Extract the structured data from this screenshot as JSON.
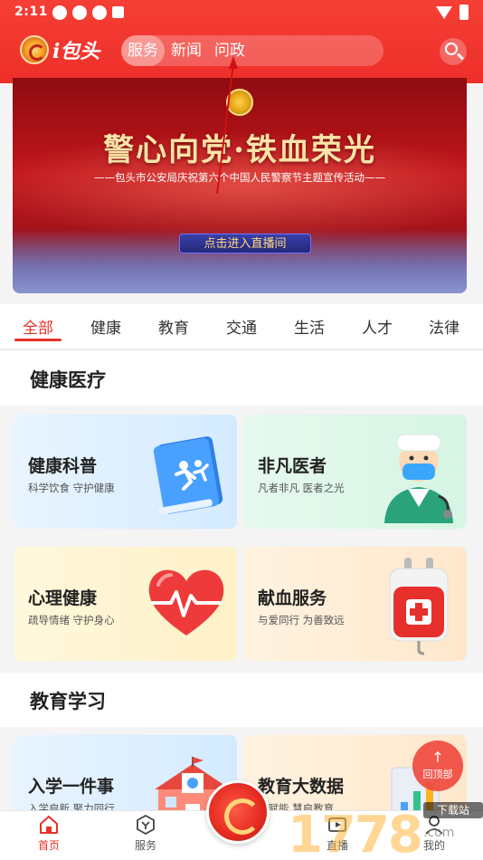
{
  "status_bar": {
    "time": "2:11",
    "left_icons": [
      "notification-icon",
      "notification-icon",
      "notification-icon",
      "app-icon"
    ],
    "right_icons": [
      "wifi-icon",
      "battery-icon"
    ]
  },
  "header": {
    "logo_text": "i包头",
    "nav": [
      {
        "label": "服务",
        "active": true
      },
      {
        "label": "新闻",
        "active": false
      },
      {
        "label": "问政",
        "active": false
      }
    ],
    "search_icon": "search-icon",
    "accent_color": "#ee2f2a"
  },
  "banner": {
    "title": "警心向党·铁血荣光",
    "subtitle": "——包头市公安局庆祝第六个中国人民警察节主题宣传活动——",
    "cta": "点击进入直播间"
  },
  "tabs": [
    {
      "label": "全部",
      "active": true
    },
    {
      "label": "健康",
      "active": false
    },
    {
      "label": "教育",
      "active": false
    },
    {
      "label": "交通",
      "active": false
    },
    {
      "label": "生活",
      "active": false
    },
    {
      "label": "人才",
      "active": false
    },
    {
      "label": "法律",
      "active": false
    }
  ],
  "sections": [
    {
      "title": "健康医疗",
      "cards": [
        {
          "title": "健康科普",
          "subtitle": "科学饮食  守护健康",
          "icon": "book-icon"
        },
        {
          "title": "非凡医者",
          "subtitle": "凡者非凡  医者之光",
          "icon": "doctor-icon"
        },
        {
          "title": "心理健康",
          "subtitle": "疏导情绪  守护身心",
          "icon": "heart-icon"
        },
        {
          "title": "献血服务",
          "subtitle": "与爱同行  为善致远",
          "icon": "blood-bag-icon"
        }
      ]
    },
    {
      "title": "教育学习",
      "cards": [
        {
          "title": "入学一件事",
          "subtitle": "入学启新  聚力同行",
          "icon": "school-icon"
        },
        {
          "title": "教育大数据",
          "subtitle": "智赋能  慧启教育",
          "icon": "data-chart-icon"
        }
      ]
    }
  ],
  "back_to_top": {
    "label": "回顶部",
    "arrow": "↑"
  },
  "bottom_nav": [
    {
      "label": "首页",
      "icon": "home-icon",
      "active": true
    },
    {
      "label": "服务",
      "icon": "service-icon",
      "active": false
    },
    {
      "label": "直播",
      "icon": "live-icon",
      "active": false
    },
    {
      "label": "我的",
      "icon": "user-icon",
      "active": false
    }
  ],
  "watermark": {
    "number": "1778",
    "tag": "下载站",
    "suffix": ".com"
  }
}
